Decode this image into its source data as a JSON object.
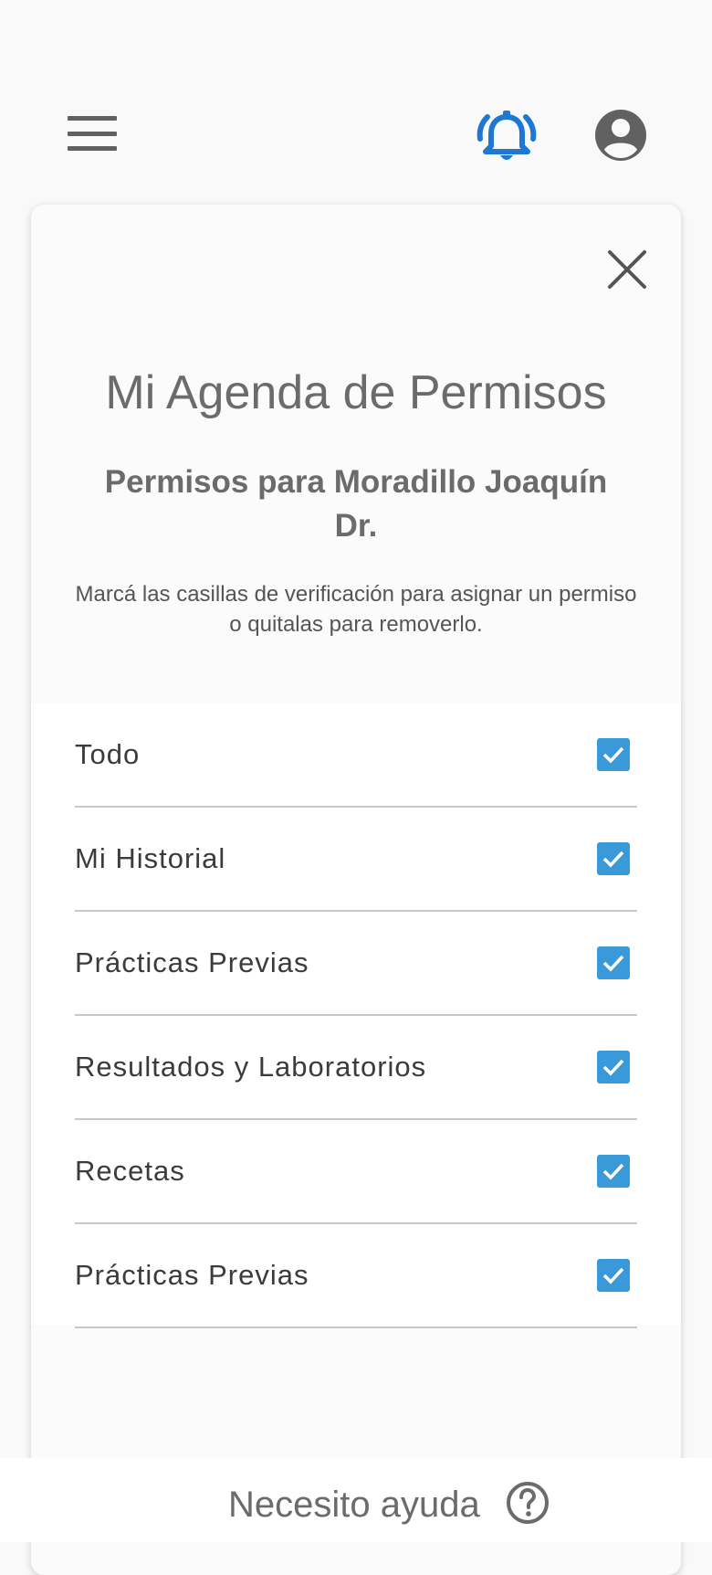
{
  "header": {
    "menu_icon": "hamburger-menu-icon",
    "notification_icon": "bell-ringing-icon",
    "profile_icon": "account-circle-icon",
    "notification_color": "#1e78d2"
  },
  "modal": {
    "title": "Mi Agenda de Permisos",
    "subtitle": "Permisos para Moradillo Joaquín Dr.",
    "description": "Marcá las casillas de verificación para asignar un permiso o quitalas para removerlo.",
    "close_icon": "close-icon",
    "permissions": [
      {
        "label": "Todo",
        "checked": true
      },
      {
        "label": "Mi Historial",
        "checked": true
      },
      {
        "label": "Prácticas Previas",
        "checked": true
      },
      {
        "label": "Resultados y Laboratorios",
        "checked": true
      },
      {
        "label": "Recetas",
        "checked": true
      },
      {
        "label": "Prácticas Previas",
        "checked": true
      }
    ],
    "checkbox_color": "#3a9ad9"
  },
  "footer": {
    "help_label": "Necesito ayuda",
    "help_icon": "question-circle-icon"
  }
}
